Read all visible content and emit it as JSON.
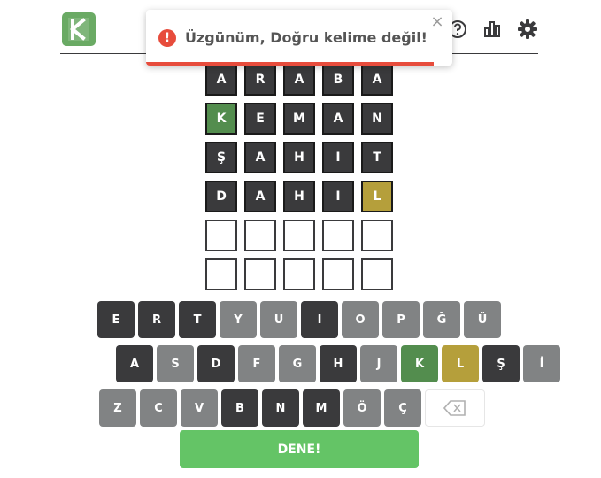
{
  "toast": {
    "message": "Üzgünüm, Doğru kelime değil!",
    "icon": "exclamation-icon",
    "close_label": "×",
    "progress": 0.94
  },
  "header": {
    "logo_icon": "k-logo-icon",
    "icons": [
      "help-icon",
      "stats-icon",
      "settings-icon"
    ]
  },
  "board": {
    "rows": [
      [
        {
          "letter": "A",
          "state": "absent"
        },
        {
          "letter": "R",
          "state": "absent"
        },
        {
          "letter": "A",
          "state": "absent"
        },
        {
          "letter": "B",
          "state": "absent"
        },
        {
          "letter": "A",
          "state": "absent"
        }
      ],
      [
        {
          "letter": "K",
          "state": "correct"
        },
        {
          "letter": "E",
          "state": "absent"
        },
        {
          "letter": "M",
          "state": "absent"
        },
        {
          "letter": "A",
          "state": "absent"
        },
        {
          "letter": "N",
          "state": "absent"
        }
      ],
      [
        {
          "letter": "Ş",
          "state": "absent"
        },
        {
          "letter": "A",
          "state": "absent"
        },
        {
          "letter": "H",
          "state": "absent"
        },
        {
          "letter": "I",
          "state": "absent"
        },
        {
          "letter": "T",
          "state": "absent"
        }
      ],
      [
        {
          "letter": "D",
          "state": "absent"
        },
        {
          "letter": "A",
          "state": "absent"
        },
        {
          "letter": "H",
          "state": "absent"
        },
        {
          "letter": "I",
          "state": "absent"
        },
        {
          "letter": "L",
          "state": "present"
        }
      ],
      [
        {
          "letter": "",
          "state": "empty"
        },
        {
          "letter": "",
          "state": "empty"
        },
        {
          "letter": "",
          "state": "empty"
        },
        {
          "letter": "",
          "state": "empty"
        },
        {
          "letter": "",
          "state": "empty"
        }
      ],
      [
        {
          "letter": "",
          "state": "empty"
        },
        {
          "letter": "",
          "state": "empty"
        },
        {
          "letter": "",
          "state": "empty"
        },
        {
          "letter": "",
          "state": "empty"
        },
        {
          "letter": "",
          "state": "empty"
        }
      ]
    ]
  },
  "keyboard": {
    "rows": [
      [
        {
          "key": "E",
          "state": "absent"
        },
        {
          "key": "R",
          "state": "absent"
        },
        {
          "key": "T",
          "state": "absent"
        },
        {
          "key": "Y",
          "state": "unused"
        },
        {
          "key": "U",
          "state": "unused"
        },
        {
          "key": "I",
          "state": "absent"
        },
        {
          "key": "O",
          "state": "unused"
        },
        {
          "key": "P",
          "state": "unused"
        },
        {
          "key": "Ğ",
          "state": "unused"
        },
        {
          "key": "Ü",
          "state": "unused"
        }
      ],
      [
        {
          "key": "A",
          "state": "absent"
        },
        {
          "key": "S",
          "state": "unused"
        },
        {
          "key": "D",
          "state": "absent"
        },
        {
          "key": "F",
          "state": "unused"
        },
        {
          "key": "G",
          "state": "unused"
        },
        {
          "key": "H",
          "state": "absent"
        },
        {
          "key": "J",
          "state": "unused"
        },
        {
          "key": "K",
          "state": "correct"
        },
        {
          "key": "L",
          "state": "present"
        },
        {
          "key": "Ş",
          "state": "absent"
        },
        {
          "key": "İ",
          "state": "unused"
        }
      ],
      [
        {
          "key": "Z",
          "state": "unused"
        },
        {
          "key": "C",
          "state": "unused"
        },
        {
          "key": "V",
          "state": "unused"
        },
        {
          "key": "B",
          "state": "absent"
        },
        {
          "key": "N",
          "state": "absent"
        },
        {
          "key": "M",
          "state": "absent"
        },
        {
          "key": "Ö",
          "state": "unused"
        },
        {
          "key": "Ç",
          "state": "unused"
        },
        {
          "key": "",
          "state": "backspace",
          "icon": "backspace-icon"
        }
      ]
    ],
    "submit_label": "DENE!"
  },
  "colors": {
    "correct": "#538d4e",
    "present": "#b59f3b",
    "absent": "#3a3a3c",
    "unused": "#818384",
    "submit": "#64c466",
    "toast_accent": "#e74c3c",
    "logo": "#6aaa64"
  }
}
